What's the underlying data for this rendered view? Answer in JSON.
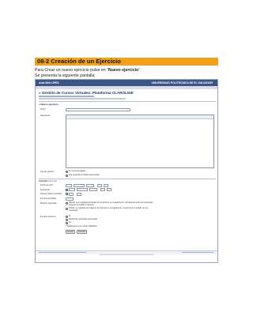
{
  "doc": {
    "title": "08-2  Creación de un Ejercicio",
    "line1_prefix": "Para Crear un nuevo ejercicio pulse en “",
    "line1_bold": "Nuevo ejercicio",
    "line1_suffix": "”.",
    "line2": "Se presenta la siguiente pantalla:"
  },
  "app": {
    "header_left": "Aula Web UPES",
    "header_right": "UNIVERSIDAD POLITECNICA DE EL SALVADOR",
    "platform_title": "» Gestión de Cursos Virtuales. Plataforma CLAROLINE",
    "section_title": "» Nuevo ejercicio",
    "form": {
      "title_label": "Título *",
      "description_label": "Descripción",
      "type_label": "Tipo de ejercicio",
      "type_options": [
        "En una única página",
        "Una pregunta por página (secuencial)"
      ],
      "advanced_label": "Avanzado",
      "advanced_link": "(Opcional)",
      "start_label": "Fecha de inicio",
      "end_label": "Fecha final",
      "time_limit_label": "Tiempo máximo permitido",
      "attempts_label": "Intentos permitidos",
      "answers_label": "Mostrar respuestas",
      "answer_options": [
        "Mostrar: se le registrará el puntaje de los alumnos en el seguimiento. Los alumnos verán sus respuestas después de realizar el ejercicio.",
        "Ocultar: se registrará el puntaje de los alumnos en el seguimiento. Los alumnos no podrán ver sus respuestas."
      ],
      "anonymous_label": "Intentos anónimos",
      "anonymous_options": [
        "Sí",
        "Mostrar las respuestas (anonimato)",
        "No"
      ],
      "required_note": "* Significa que es un campo obligatorio",
      "ok_button": "Aceptar",
      "cancel_button": "Cancelar"
    }
  }
}
